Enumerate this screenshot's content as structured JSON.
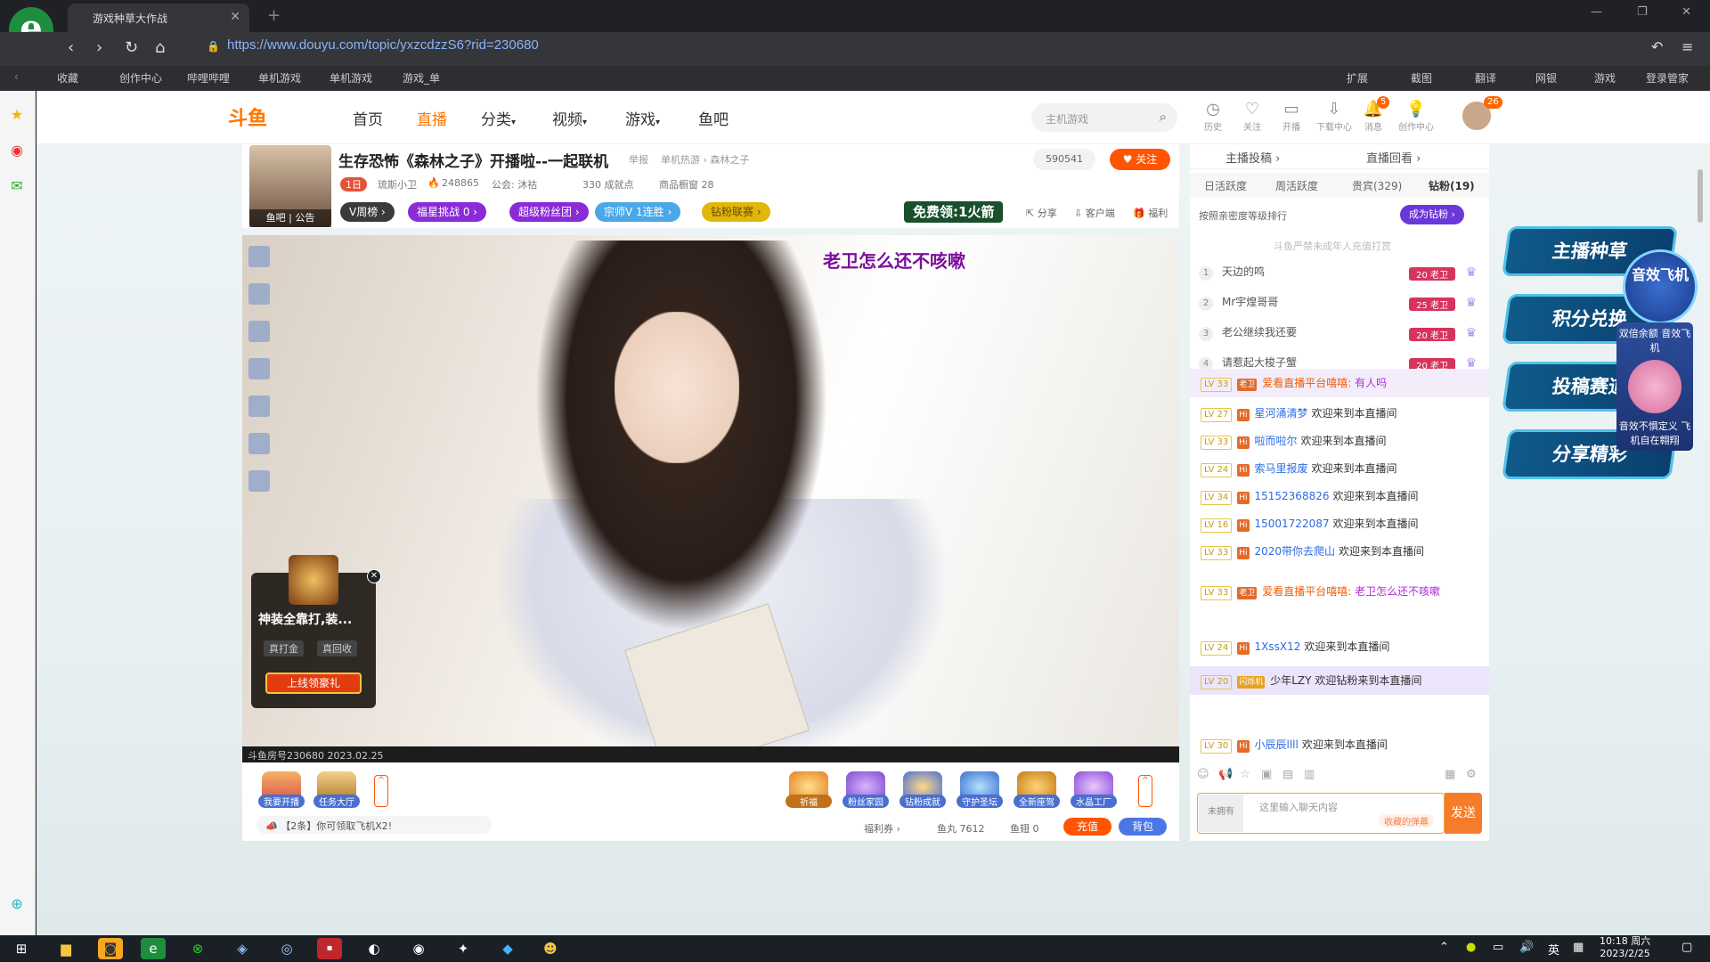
{
  "browser": {
    "tab_title": "游戏种草大作战",
    "url": "https://www.douyu.com/topic/yxzcdzzS6?rid=230680",
    "bookmarks": [
      "收藏",
      "创作中心",
      "哔哩哔哩",
      "单机游戏",
      "单机游戏",
      "游戏_单"
    ],
    "right_tools": [
      "扩展",
      "截图",
      "翻译",
      "网银",
      "游戏",
      "登录管家"
    ]
  },
  "site": {
    "logo_text": "斗鱼",
    "nav": [
      "首页",
      "直播",
      "分类",
      "视频",
      "游戏",
      "鱼吧"
    ],
    "active_nav": "直播",
    "search_placeholder": "主机游戏",
    "tools": [
      "历史",
      "关注",
      "开播",
      "下载中心",
      "消息",
      "创作中心"
    ],
    "message_badge": "5",
    "avatar_badge": "26"
  },
  "room": {
    "title": "生存恐怖《森林之子》开播啦--一起联机",
    "report": "举报",
    "category_path": "单机热游 › 森林之子",
    "follow_count": "590541",
    "follow_label": "关注",
    "streamer_level": "1日",
    "streamer_name": "琉斯小卫",
    "heat": "248865",
    "guild": "公会: 沐祜",
    "achievement": "330 成就点",
    "shop": "商品橱窗 28",
    "avatar_caption": "鱼吧 | 公告",
    "pills": [
      {
        "label": "V周榜",
        "color": "#3a3a3a"
      },
      {
        "label": "福星挑战 0",
        "color": "#8a2bd8"
      },
      {
        "label": "超级粉丝团",
        "color": "#8a2bd8"
      },
      {
        "label": "宗师V 1连胜",
        "color": "#4aa7e8"
      },
      {
        "label": "钻粉联赛",
        "color": "#e2b70c"
      }
    ],
    "free_rocket": "免费领:1火箭",
    "actions": [
      "分享",
      "客户端",
      "福利"
    ]
  },
  "video": {
    "danmu": "老卫怎么还不咳嗽",
    "taskbar_text": "斗鱼房号230680 2023.02.25",
    "promo": {
      "title": "神装全靠打,装...",
      "btn1": "真打金",
      "btn2": "真回收",
      "cta": "上线领豪礼"
    }
  },
  "bottom": {
    "gifts_left": [
      "我要开播",
      "任务大厅"
    ],
    "gifts_right": [
      "祈福",
      "粉丝家园",
      "钻粉成就",
      "守护圣坛",
      "全新座驾",
      "水晶工厂"
    ],
    "notice": "【2条】你可领取飞机X2!",
    "welfare": "福利券",
    "fish_balls": "鱼丸 7612",
    "fish_fins": "鱼翅 0",
    "recharge": "充值",
    "backpack": "背包"
  },
  "panel": {
    "top_tabs": [
      "主播投稿",
      "直播回看"
    ],
    "rank_tabs": [
      "日活跃度",
      "周活跃度",
      "贵宾(329)",
      "钻粉(19)"
    ],
    "active_rank_tab": "钻粉(19)",
    "rank_sort": "按照亲密度等级排行",
    "become_fan": "成为钻粉",
    "rank_note": "斗鱼严禁未成年人充值打赏",
    "ranking": [
      {
        "rank": "1",
        "name": "天边的鸣",
        "level": "20",
        "tag": "老卫"
      },
      {
        "rank": "2",
        "name": "Mr宇煌哥哥",
        "level": "25",
        "tag": "老卫"
      },
      {
        "rank": "3",
        "name": "老公继续我还要",
        "level": "20",
        "tag": "老卫"
      },
      {
        "rank": "4",
        "name": "请惹起大梭子蟹",
        "level": "20",
        "tag": "老卫"
      }
    ],
    "chat": [
      {
        "lv": "LV 33",
        "badge": "老卫",
        "user": "爱看直播平台嘻嘻:",
        "msg": "有人吗",
        "style": "highlight"
      },
      {
        "lv": "LV 27",
        "user": "星河涌清梦",
        "msg": "欢迎来到本直播间"
      },
      {
        "lv": "LV 33",
        "user": "啦而啦尔",
        "msg": "欢迎来到本直播间"
      },
      {
        "lv": "LV 24",
        "user": "索马里报废",
        "msg": "欢迎来到本直播间"
      },
      {
        "lv": "LV 34",
        "user": "15152368826",
        "msg": "欢迎来到本直播间"
      },
      {
        "lv": "LV 16",
        "user": "15001722087",
        "msg": "欢迎来到本直播间"
      },
      {
        "lv": "LV 33",
        "user": "2020带你去爬山",
        "msg": "欢迎来到本直播间"
      },
      {
        "lv": "LV 33",
        "badge": "老卫",
        "user": "爱看直播平台嘻嘻:",
        "msg": "老卫怎么还不咳嗽",
        "style": "orange"
      },
      {
        "lv": "LV 24",
        "user": "1XssX12",
        "msg": "欢迎来到本直播间"
      },
      {
        "lv": "LV 20",
        "badge": "闪烁机",
        "user": "少年LZY",
        "msg": "欢迎钻粉来到本直播间",
        "style": "purple"
      },
      {
        "lv": "LV 30",
        "user": "小辰辰llll",
        "msg": "欢迎来到本直播间"
      }
    ],
    "chat_user": "未拥有",
    "chat_placeholder": "这里输入聊天内容",
    "hint": "收藏的弹幕",
    "send": "发送"
  },
  "floating": {
    "banners": [
      "主播种草",
      "积分兑换",
      "投稿赛道",
      "分享精彩"
    ],
    "badge": "音效飞机",
    "ad_top": "双倍余额 音效飞机",
    "ad_bottom": "音效不惧定义 飞机自在翱翔"
  },
  "os": {
    "time": "10:18 周六",
    "date": "2023/2/25",
    "ime": "英"
  }
}
